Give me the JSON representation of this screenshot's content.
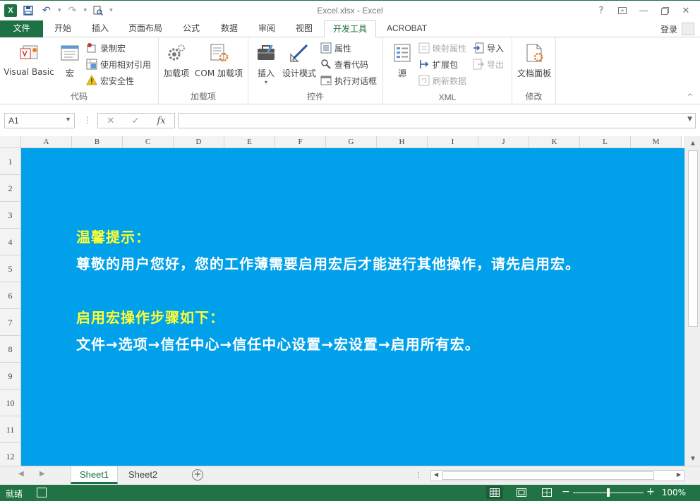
{
  "window": {
    "title": "Excel.xlsx - Excel",
    "help": "?",
    "login": "登录"
  },
  "tabs": [
    "文件",
    "开始",
    "插入",
    "页面布局",
    "公式",
    "数据",
    "审阅",
    "视图",
    "开发工具",
    "ACROBAT"
  ],
  "active_tab": "开发工具",
  "ribbon": {
    "code": {
      "label": "代码",
      "visual_basic": "Visual Basic",
      "macros": "宏",
      "record_macro": "录制宏",
      "use_relative": "使用相对引用",
      "macro_security": "宏安全性"
    },
    "addins": {
      "label": "加载项",
      "addins": "加载项",
      "com_addins": "COM 加载项"
    },
    "controls": {
      "label": "控件",
      "insert": "插入",
      "design_mode": "设计模式",
      "properties": "属性",
      "view_code": "查看代码",
      "run_dialog": "执行对话框"
    },
    "xml": {
      "label": "XML",
      "source": "源",
      "map_properties": "映射属性",
      "expansion_packs": "扩展包",
      "refresh_data": "刷新数据",
      "import": "导入",
      "export": "导出"
    },
    "modify": {
      "label": "修改",
      "document_panel": "文档面板"
    }
  },
  "formula_bar": {
    "name_box": "A1",
    "fx": "fx",
    "formula": ""
  },
  "columns": [
    "A",
    "B",
    "C",
    "D",
    "E",
    "F",
    "G",
    "H",
    "I",
    "J",
    "K",
    "L",
    "M"
  ],
  "rows": [
    "1",
    "2",
    "3",
    "4",
    "5",
    "6",
    "7",
    "8",
    "9",
    "10",
    "11",
    "12"
  ],
  "message": {
    "tip_title": "温馨提示：",
    "tip_body": "尊敬的用户您好，您的工作薄需要启用宏后才能进行其他操作，请先启用宏。",
    "steps_title": "启用宏操作步骤如下：",
    "steps_body": "文件→选项→信任中心→信任中心设置→宏设置→启用所有宏。"
  },
  "sheets": [
    "Sheet1",
    "Sheet2"
  ],
  "active_sheet": "Sheet1",
  "status": {
    "ready": "就绪",
    "zoom": "100%"
  },
  "colors": {
    "excel_green": "#217346",
    "banner_blue": "#00a0ea",
    "title_yellow": "#ffff33"
  }
}
